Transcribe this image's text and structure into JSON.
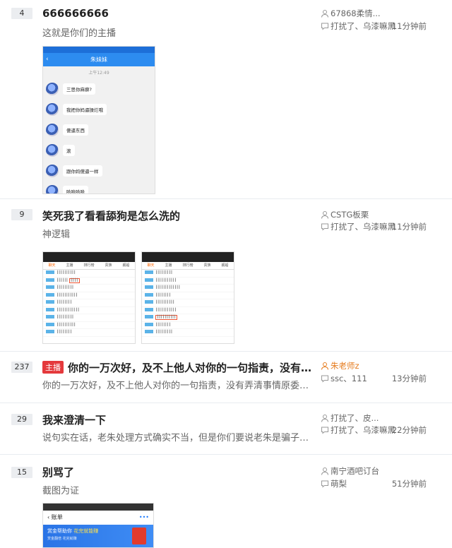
{
  "threads": [
    {
      "reply_count": "4",
      "title": "666666666",
      "abstract": "这就是你们的主播",
      "author": "67868柔情...",
      "last_reply": "打扰了、乌漆嘛黑",
      "time": "11分钟前",
      "screenshot": {
        "chat_title": "朱妹妹",
        "time": "上午12:49",
        "messages": [
          "三思你麻痹?",
          "我把你妈逼操烂哦",
          "傻逼东西",
          "滚",
          "跟你妈傻逼一样",
          "哈哈哈哈"
        ]
      }
    },
    {
      "reply_count": "9",
      "title": "笑死我了看看舔狗是怎么洗的",
      "abstract": "神逻辑",
      "author": "CSTG板栗",
      "last_reply": "打扰了、乌漆嘛黑",
      "time": "11分钟前",
      "chat_tabs": [
        "聊天",
        "主播",
        "排行榜",
        "贵族",
        "舰船"
      ]
    },
    {
      "reply_count": "237",
      "top_tag": "主播",
      "title": "你的一万次好，及不上他人对你的一句指责，没有弄清...",
      "abstract": "你的一万次好，及不上他人对你的一句指责，没有弄清事情原委疯狂...",
      "author": "朱老师z",
      "last_reply": "ssc、111",
      "time": "13分钟前"
    },
    {
      "reply_count": "29",
      "title": "我来澄清一下",
      "abstract": "说句实在话，老朱处理方式确实不当，但是你们要说老朱是骗子那你...",
      "author": "打扰了、皮...",
      "last_reply": "打扰了、乌漆嘛黑",
      "time": "22分钟前"
    },
    {
      "reply_count": "15",
      "title": "别骂了",
      "abstract": "截图为证",
      "author": "南宁酒吧订台",
      "last_reply": "萌梨",
      "time": "51分钟前",
      "screenshot": {
        "bar_title": "账单",
        "ad_title": "赏金帮助你",
        "ad_highlight": "花完就能赚",
        "ad_sub": "赏金翻倍 花完就赚"
      }
    }
  ],
  "colors": {
    "accent": "#e4393c",
    "author_highlight": "#e67e22",
    "blue": "#2d8cf0"
  }
}
